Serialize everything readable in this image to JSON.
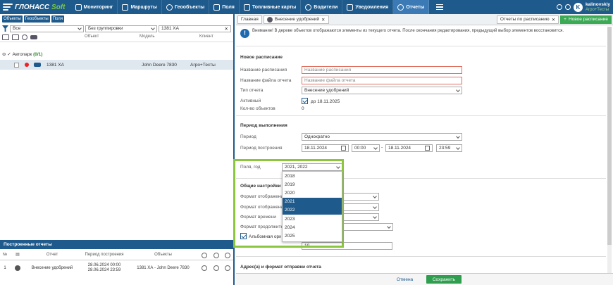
{
  "app": {
    "logo_main": "ГЛОНАСС",
    "logo_soft": "Soft"
  },
  "nav": [
    {
      "label": "Мониторинг",
      "icon": "monitor-icon"
    },
    {
      "label": "Маршруты",
      "icon": "route-icon"
    },
    {
      "label": "Геообъекты",
      "icon": "geo-icon"
    },
    {
      "label": "Поля",
      "icon": "field-icon"
    },
    {
      "label": "Топливные карты",
      "icon": "fuel-icon"
    },
    {
      "label": "Водители",
      "icon": "driver-icon"
    },
    {
      "label": "Уведомления",
      "icon": "mail-icon"
    },
    {
      "label": "Отчеты",
      "icon": "report-icon"
    }
  ],
  "user": {
    "initial": "K",
    "name": "kalinovskiy",
    "org": "Агро+Тесты"
  },
  "left": {
    "tabs": [
      "Объекты",
      "Геообъекты",
      "Поля"
    ],
    "filter_all": "Все",
    "grouping": "Без группировки",
    "search": "1381 ХА",
    "columns": {
      "object": "Объект",
      "model": "Модель",
      "client": "Клиент"
    },
    "group": {
      "name": "Автопарк",
      "count": "(0/1)"
    },
    "row": {
      "object": "1381 ХА",
      "model": "John Deere 7830",
      "client": "Агро+Тесты"
    },
    "built_title": "Построенные отчеты",
    "built_columns": {
      "no": "№",
      "report": "Отчет",
      "period": "Период построения",
      "objects": "Объекты"
    },
    "built_row": {
      "no": "1",
      "report": "Внесение удобрений",
      "period_from": "28.06.2024 00:00",
      "period_to": "28.06.2024 23:59",
      "objects": "1381 ХА - John Deere 7830"
    }
  },
  "right": {
    "tabs": [
      {
        "label": "Главная"
      },
      {
        "label": "Внесение удобрений"
      },
      {
        "label": "Отчеты по расписанию"
      },
      {
        "label": "Новое расписание"
      }
    ],
    "notice": "Внимание! В дереве объектов отображаются элементы из текущего отчета. После окончания редактирования, предыдущий выбор элементов восстановится.",
    "new_schedule": "Новое расписание",
    "schedule_name_label": "Название расписания",
    "schedule_name_ph": "Название расписания",
    "file_name_label": "Название файла отчета",
    "file_name_ph": "Название файла отчета",
    "report_type_label": "Тип отчета",
    "report_type": "Внесение удобрений",
    "active_label": "Активный",
    "active_until": "до 18.11.2025",
    "objects_count_label": "Кол-во объектов",
    "objects_count": "0",
    "period_section": "Период выполнения",
    "period_label": "Период",
    "period": "Однократно",
    "build_period_label": "Период построения",
    "date_from": "18.11.2024",
    "time_from": "00:00",
    "dash": "-",
    "date_to": "18.11.2024",
    "time_to": "23:59",
    "fields_year_label": "Поля, год",
    "fields_year": "2021, 2022",
    "years": [
      "2018",
      "2019",
      "2020",
      "2021",
      "2022",
      "2023",
      "2024",
      "2025"
    ],
    "selected_years": [
      "2021",
      "2022"
    ],
    "general_section": "Общие настройки",
    "fmt1": "Формат отображения",
    "fmt2": "Формат отображения",
    "fmt_time": "Формат времени",
    "fmt_dur": "Формат продолжительности",
    "landscape": "Альбомная ориентация",
    "extra_value": "10",
    "email_section": "Адрес(а) и формат отправки отчета",
    "cancel": "Отмена",
    "save": "Сохранить"
  }
}
